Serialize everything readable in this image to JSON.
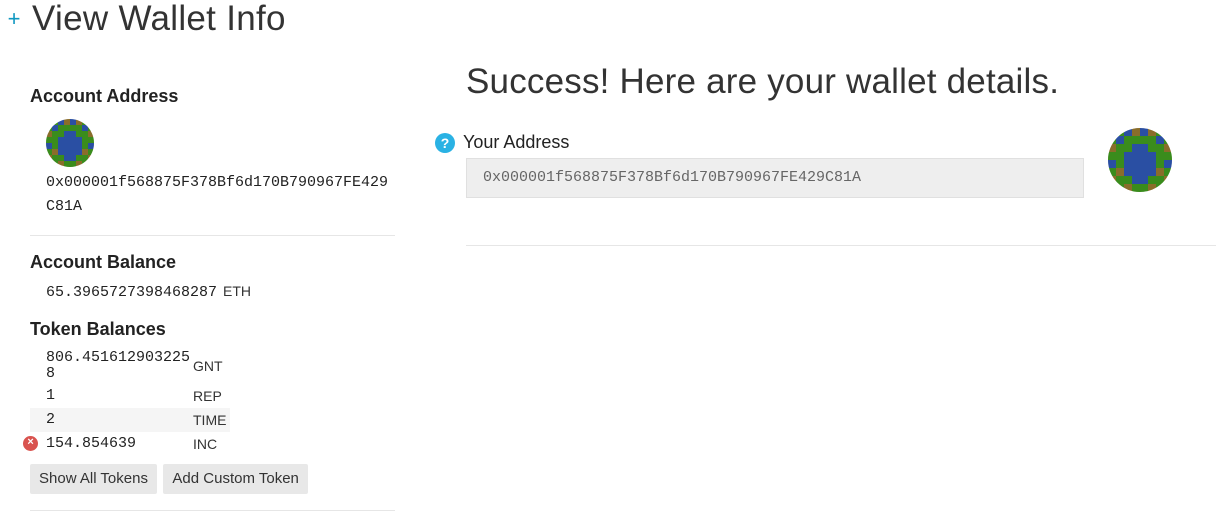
{
  "header": {
    "plus_symbol": "+",
    "title": "View Wallet Info"
  },
  "sidebar": {
    "account_address_heading": "Account Address",
    "address": "0x000001f568875F378Bf6d170B790967FE429C81A",
    "account_balance_heading": "Account Balance",
    "balance_value": "65.3965727398468287",
    "balance_unit": "ETH",
    "token_balances_heading": "Token Balances",
    "tokens": [
      {
        "amount": "806.4516129032258",
        "symbol": "GNT"
      },
      {
        "amount": "1",
        "symbol": "REP"
      },
      {
        "amount": "2",
        "symbol": "TIME"
      },
      {
        "amount": "154.854639",
        "symbol": "INC",
        "removable": true
      }
    ],
    "show_all_tokens_label": "Show All Tokens",
    "add_custom_token_label": "Add Custom Token"
  },
  "main": {
    "success_title": "Success! Here are your wallet details.",
    "your_address_label": "Your Address",
    "address_value": "0x000001f568875F378Bf6d170B790967FE429C81A"
  },
  "icons": {
    "plus": "plus-icon",
    "help": "question-mark-icon",
    "remove": "remove-token-icon",
    "identicon": "blockie-identicon"
  },
  "colors": {
    "accent": "#0e97c0",
    "help_icon": "#2ab2e4",
    "remove_icon": "#d9534f",
    "identicon_green": "#3a8c1c",
    "identicon_blue": "#2a4fa3",
    "identicon_brown": "#8a6d2a"
  }
}
